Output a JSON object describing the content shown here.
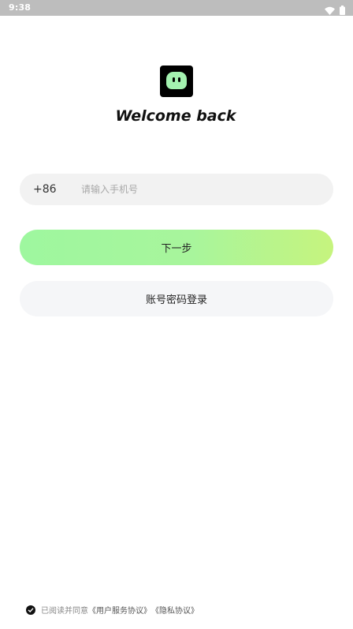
{
  "status_bar": {
    "time": "9:38",
    "icons": [
      "wifi-icon",
      "battery-icon"
    ]
  },
  "logo": {
    "icon": "ghost-face-icon",
    "colors": {
      "background": "#000000",
      "face": "#a4f2b0"
    }
  },
  "title": "Welcome back",
  "phone": {
    "country_code": "+86",
    "value": "",
    "placeholder": "请输入手机号"
  },
  "buttons": {
    "next_label": "下一步",
    "password_login_label": "账号密码登录"
  },
  "agreement": {
    "checked": true,
    "prefix": "已阅读并同意",
    "user_agreement": "《用户服务协议》",
    "privacy_policy": "《隐私协议》"
  },
  "colors": {
    "accent_gradient_start": "#9ef79f",
    "accent_gradient_end": "#c6f47e",
    "field_bg": "#f2f2f2"
  }
}
